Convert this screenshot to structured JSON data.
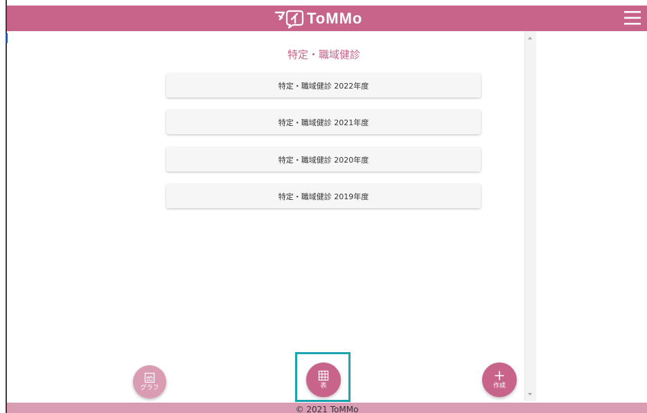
{
  "header": {
    "logo_text": "ToMMo",
    "logo_prefix": "マイ",
    "menu_icon": "hamburger-menu-icon",
    "color": "#c8648a"
  },
  "main": {
    "title": "特定・職域健診",
    "items": [
      {
        "label": "特定・職域健診 2022年度"
      },
      {
        "label": "特定・職域健診 2021年度"
      },
      {
        "label": "特定・職域健診 2020年度"
      },
      {
        "label": "特定・職域健診 2019年度"
      }
    ]
  },
  "actions": {
    "graph": {
      "label": "グラフ",
      "icon": "chart-icon"
    },
    "table": {
      "label": "表",
      "icon": "table-grid-icon"
    },
    "create": {
      "label": "作成",
      "icon": "plus-icon"
    }
  },
  "footer": {
    "copyright": "© 2021 ToMMo"
  },
  "highlight_color": "#1aa4b0"
}
